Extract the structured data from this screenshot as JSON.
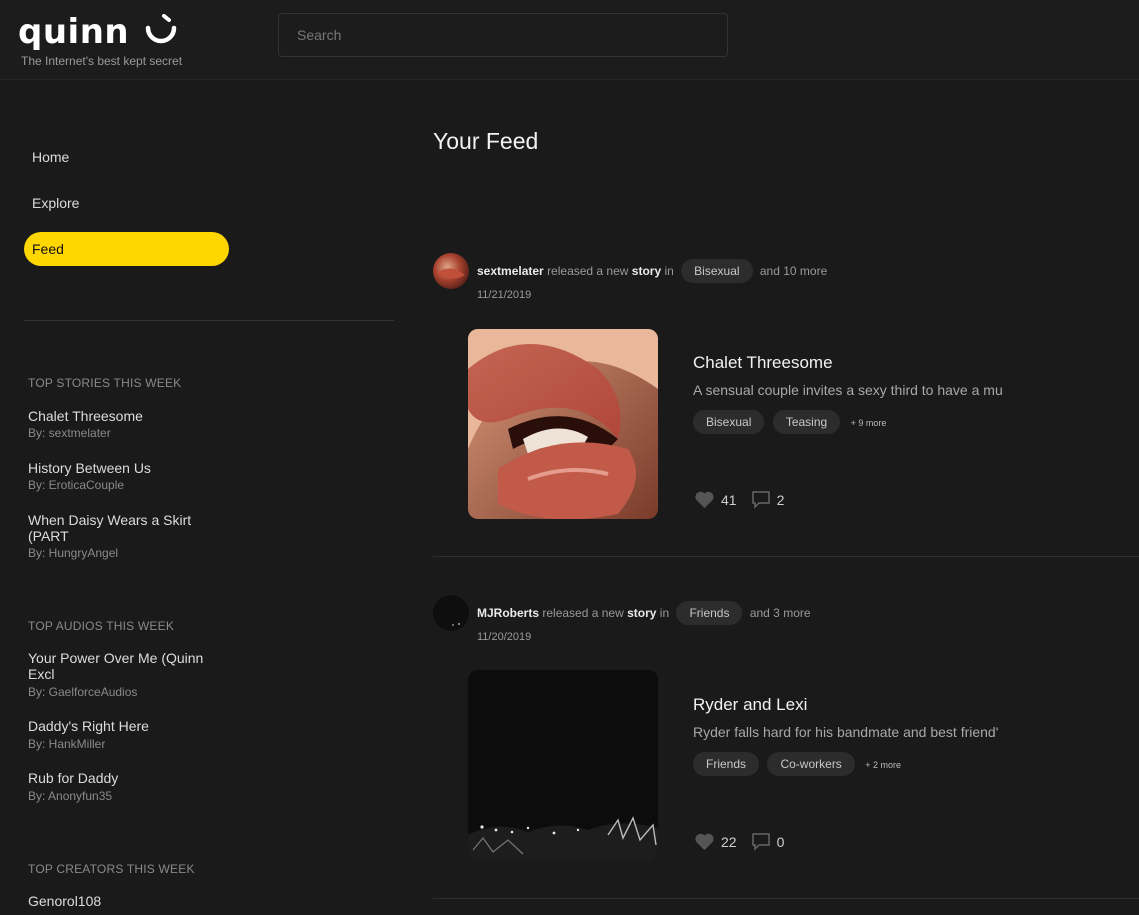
{
  "header": {
    "logo": "quinn",
    "tagline": "The Internet's best kept secret",
    "search_placeholder": "Search"
  },
  "nav": [
    {
      "label": "Home"
    },
    {
      "label": "Explore"
    },
    {
      "label": "Feed",
      "active": true
    }
  ],
  "sidebar": {
    "top_stories": {
      "heading": "TOP STORIES THIS WEEK",
      "items": [
        {
          "title": "Chalet Threesome",
          "by": "By: sextmelater"
        },
        {
          "title": "History Between Us",
          "by": "By: EroticaCouple"
        },
        {
          "title": "When Daisy Wears a Skirt (PART",
          "by": "By: HungryAngel"
        }
      ]
    },
    "top_audios": {
      "heading": "TOP AUDIOS THIS WEEK",
      "items": [
        {
          "title": "Your Power Over Me (Quinn Excl",
          "by": "By: GaelforceAudios"
        },
        {
          "title": "Daddy's Right Here",
          "by": "By: HankMiller"
        },
        {
          "title": "Rub for Daddy",
          "by": "By: Anonyfun35"
        }
      ]
    },
    "top_creators": {
      "heading": "TOP CREATORS THIS WEEK",
      "items": [
        {
          "name": "Genorol108"
        }
      ]
    }
  },
  "main": {
    "title": "Your Feed",
    "feed": [
      {
        "author": "sextmelater",
        "action": "released a new",
        "kind": "story",
        "in": "in",
        "category": "Bisexual",
        "more": "and 10 more",
        "date": "11/21/2019",
        "title": "Chalet Threesome",
        "description": "A sensual couple invites a sexy third to have a mu",
        "tags": [
          "Bisexual",
          "Teasing"
        ],
        "tags_more": "+ 9 more",
        "likes": "41",
        "comments": "2"
      },
      {
        "author": "MJRoberts",
        "action": "released a new",
        "kind": "story",
        "in": "in",
        "category": "Friends",
        "more": "and 3 more",
        "date": "11/20/2019",
        "title": "Ryder and Lexi",
        "description": "Ryder falls hard for his bandmate and best friend'",
        "tags": [
          "Friends",
          "Co-workers"
        ],
        "tags_more": "+ 2 more",
        "likes": "22",
        "comments": "0"
      }
    ]
  },
  "colors": {
    "accent": "#ffd600",
    "background": "#1a1a1a"
  },
  "icons": [
    "smile-logo-icon",
    "heart-icon",
    "comment-icon"
  ]
}
